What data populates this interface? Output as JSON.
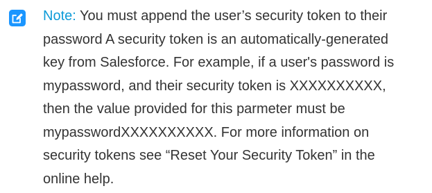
{
  "note": {
    "icon": "edit-note-icon",
    "accent_color": "#1b96ff",
    "label": "Note:",
    "lines": [
      "You must append the user’s security token to their",
      "password A security token is an automatically-generated",
      "key from Salesforce. For example, if a user's password is",
      "mypassword, and their security token is XXXXXXXXXX,",
      "then the value provided for this parmeter must be",
      "mypasswordXXXXXXXXXX. For more information on",
      "security tokens see “Reset Your Security Token” in the",
      "online help."
    ]
  }
}
